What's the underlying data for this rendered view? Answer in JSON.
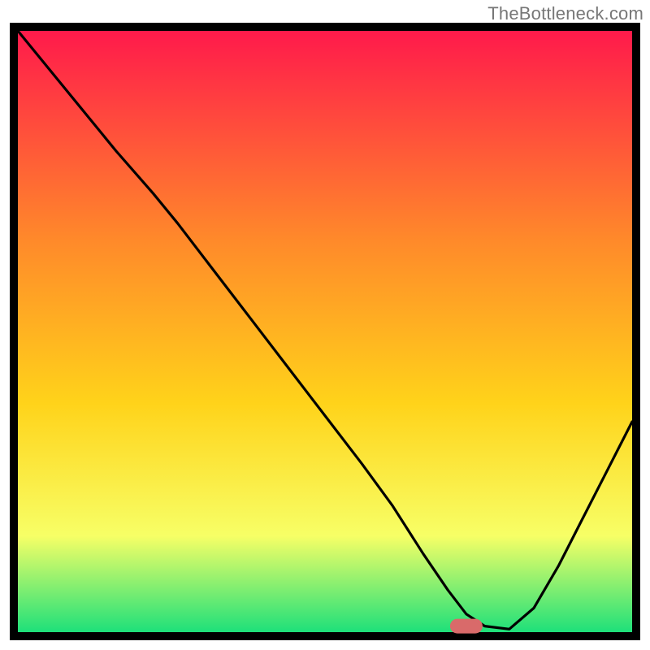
{
  "watermark": "TheBottleneck.com",
  "chart_data": {
    "type": "line",
    "title": "",
    "xlabel": "",
    "ylabel": "",
    "xlim": [
      0,
      100
    ],
    "ylim": [
      0,
      100
    ],
    "gradient": {
      "top_color": "#ff1a4b",
      "mid_upper_color": "#ff8a2a",
      "mid_color": "#ffd31a",
      "mid_lower_color": "#f7ff66",
      "bottom_color": "#1ee07a"
    },
    "x": [
      0,
      8,
      16,
      22,
      26,
      32,
      38,
      44,
      50,
      56,
      61,
      66,
      70,
      73,
      76,
      80,
      84,
      88,
      92,
      96,
      100
    ],
    "values": [
      100,
      90,
      80,
      73,
      68,
      60,
      52,
      44,
      36,
      28,
      21,
      13,
      7,
      3,
      1,
      0.5,
      4,
      11,
      19,
      27,
      35
    ],
    "marker": {
      "x": 73,
      "y": 1
    }
  }
}
